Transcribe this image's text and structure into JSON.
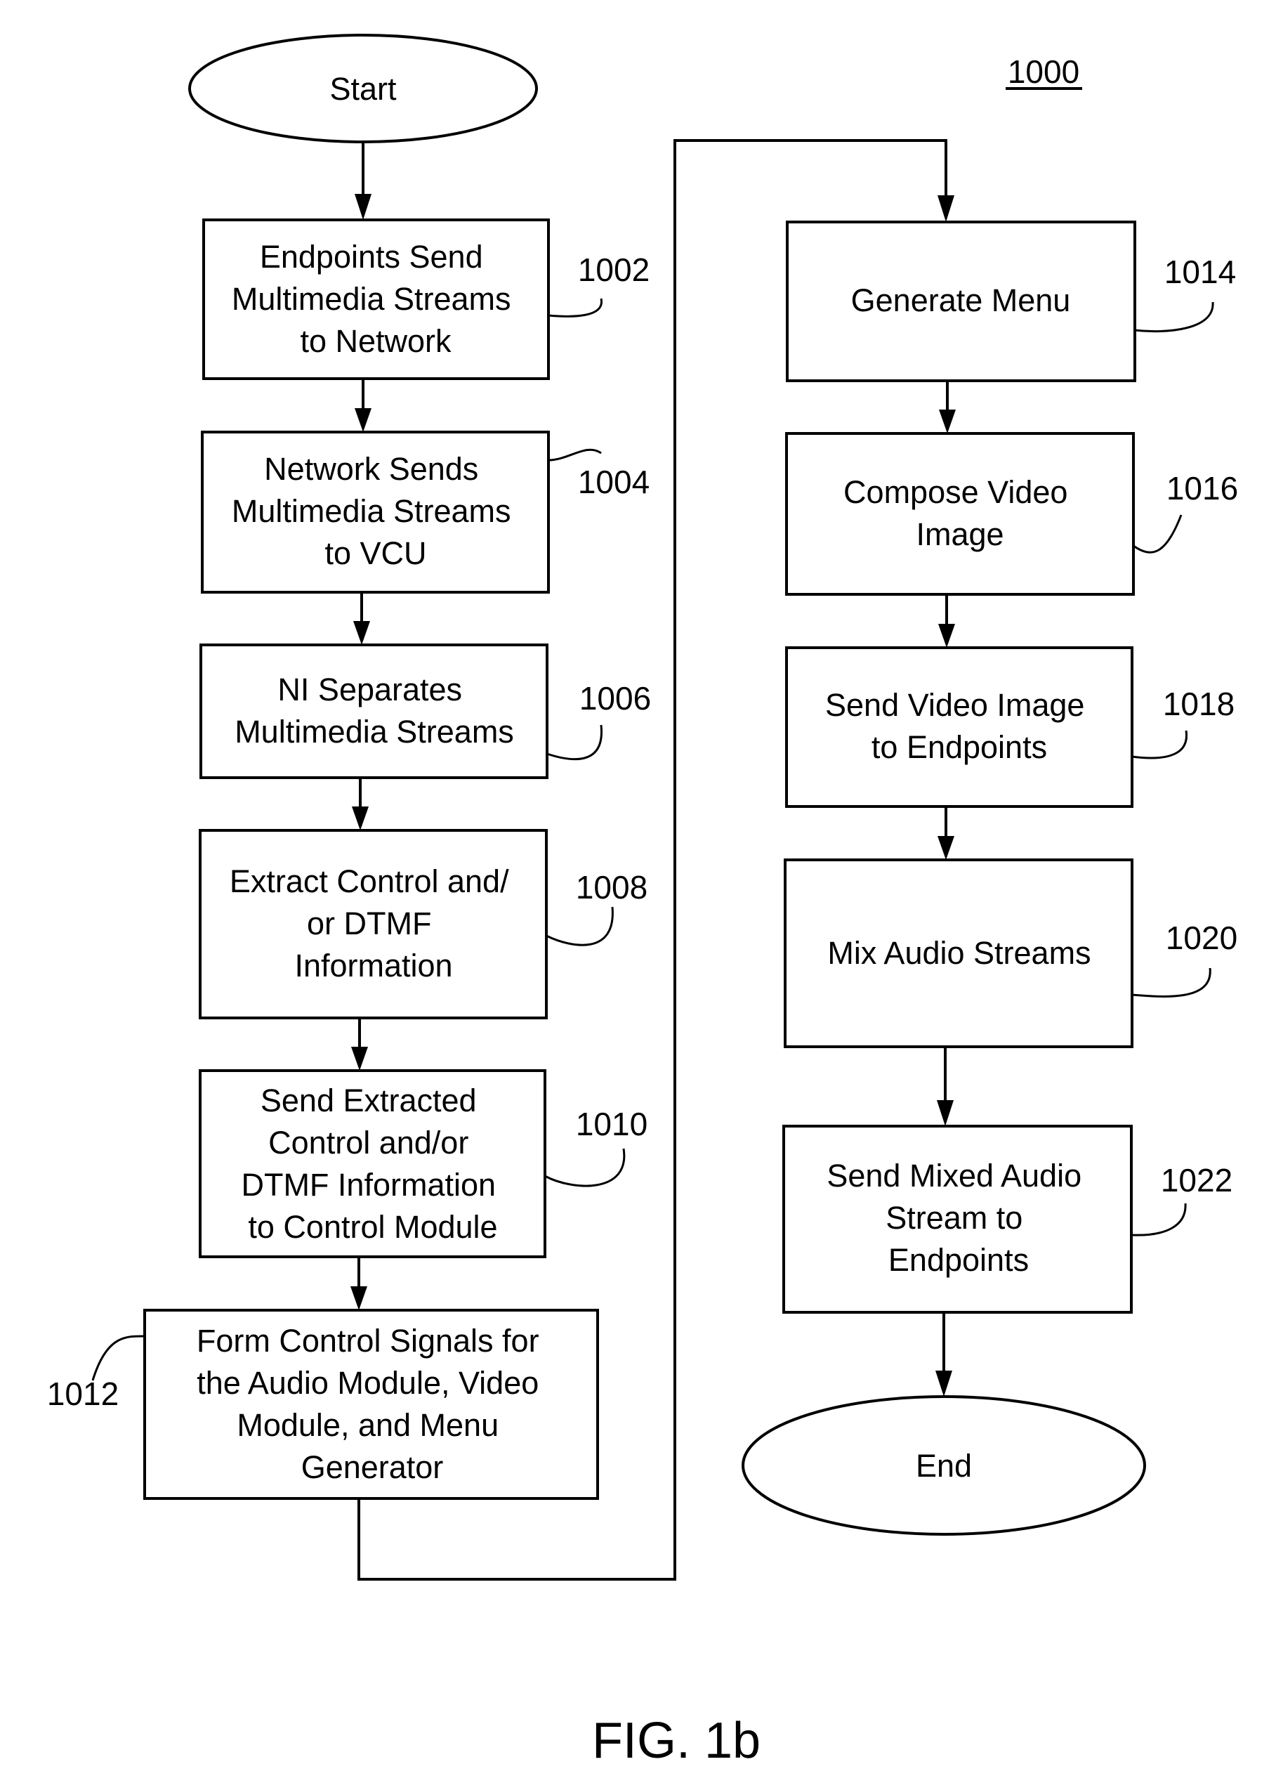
{
  "figure": {
    "reference": "1000",
    "caption": "FIG. 1b"
  },
  "terminals": {
    "start": "Start",
    "end": "End"
  },
  "steps": [
    {
      "id": "1002",
      "lines": [
        "Endpoints Send",
        "Multimedia Streams",
        "to Network"
      ]
    },
    {
      "id": "1004",
      "lines": [
        "Network Sends",
        "Multimedia Streams",
        "to VCU"
      ]
    },
    {
      "id": "1006",
      "lines": [
        "NI Separates",
        "Multimedia Streams"
      ]
    },
    {
      "id": "1008",
      "lines": [
        "Extract Control and/",
        "or DTMF",
        "Information"
      ]
    },
    {
      "id": "1010",
      "lines": [
        "Send Extracted",
        "Control and/or",
        "DTMF Information",
        "to Control Module"
      ]
    },
    {
      "id": "1012",
      "lines": [
        "Form Control Signals for",
        "the Audio Module, Video",
        "Module, and Menu",
        "Generator"
      ]
    },
    {
      "id": "1014",
      "lines": [
        "Generate Menu"
      ]
    },
    {
      "id": "1016",
      "lines": [
        "Compose Video",
        "Image"
      ]
    },
    {
      "id": "1018",
      "lines": [
        "Send Video Image",
        "to Endpoints"
      ]
    },
    {
      "id": "1020",
      "lines": [
        "Mix Audio Streams"
      ]
    },
    {
      "id": "1022",
      "lines": [
        "Send Mixed Audio",
        "Stream to",
        "Endpoints"
      ]
    }
  ],
  "flow": [
    "start",
    "1002",
    "1004",
    "1006",
    "1008",
    "1010",
    "1012",
    "1014",
    "1016",
    "1018",
    "1020",
    "1022",
    "end"
  ]
}
